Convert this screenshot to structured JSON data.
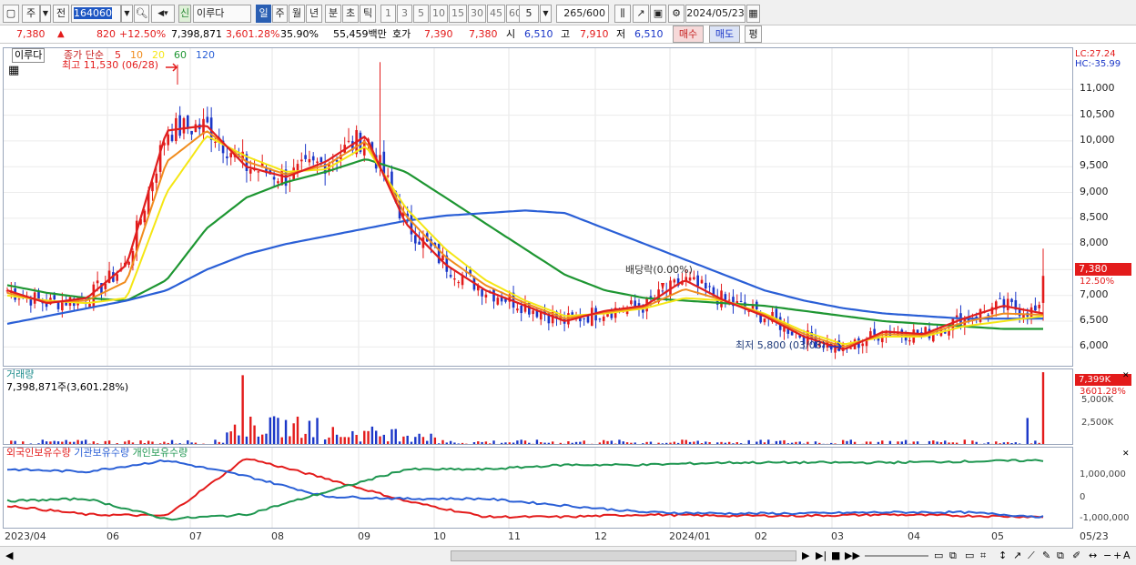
{
  "toolbar": {
    "market_label": "주",
    "period_label": "전",
    "code": "164060",
    "stock_name": "이루다",
    "badge_label": "신",
    "tf_daily": "일",
    "tf_week": "주",
    "tf_month": "월",
    "tf_year": "년",
    "tf_minute": "분",
    "tf_second": "초",
    "tf_tick": "틱",
    "intervals": [
      "1",
      "3",
      "5",
      "10",
      "15",
      "30",
      "45",
      "60"
    ],
    "interval_sel": "5",
    "count_value": "265",
    "count_total": "/600",
    "date_value": "2024/05/23"
  },
  "quote": {
    "price": "7,380",
    "change": "820",
    "change_pct": "+12.50%",
    "volume": "7,398,871",
    "volume_pct": "3,601.28%",
    "turnover": "35.90%",
    "amount": "55,459백만",
    "hoga_label": "호가",
    "hoga_ask": "7,390",
    "hoga_bid": "7,380",
    "open_label": "시",
    "open": "6,510",
    "high_label": "고",
    "high": "7,910",
    "low_label": "저",
    "low": "6,510",
    "buy_label": "매수",
    "sell_label": "매도",
    "eval_label": "평"
  },
  "main_panel": {
    "name_tag": "이루다",
    "ma_title": "종가 단순",
    "ma_periods": [
      "5",
      "10",
      "20",
      "60",
      "120"
    ],
    "max_label": "최고 11,530 (06/28)",
    "min_label": "최저 5,800 (03/08)",
    "dividend_label": "배당락(0.00%)",
    "lc_label": "LC:27.24",
    "hc_label": "HC:-35.99",
    "price_tag": "7,380",
    "price_tag_pct": "12.50%",
    "y_ticks": [
      "11,000",
      "10,500",
      "10,000",
      "9,500",
      "9,000",
      "8,500",
      "8,000",
      "7,500",
      "7,000",
      "6,500",
      "6,000"
    ]
  },
  "volume_panel": {
    "title": "거래량",
    "value_label": "7,398,871주(3,601.28%)",
    "tag": "7,399K",
    "tag_pct": "3601.28%",
    "y_ticks": [
      "5,000K",
      "2,500K"
    ]
  },
  "holding_panel": {
    "legend": [
      "외국인보유수량",
      "기관보유수량",
      "개인보유수량"
    ],
    "y_ticks": [
      "1,000,000",
      "0",
      "-1,000,000"
    ]
  },
  "x_axis": [
    "2023/04",
    "06",
    "07",
    "08",
    "09",
    "10",
    "11",
    "12",
    "2024/01",
    "02",
    "03",
    "04",
    "05",
    "05/23"
  ],
  "colors": {
    "ma5": "#e01e1e",
    "ma10": "#f08c1e",
    "ma20": "#f5e614",
    "ma60": "#1e9632",
    "ma120": "#2a5fd6",
    "up": "#e31b1b",
    "down": "#1b37c8"
  },
  "chart_data": [
    {
      "type": "candlestick",
      "title": "이루다",
      "ylim": [
        5600,
        11800
      ],
      "x": [
        "2023/04",
        "06",
        "07",
        "08",
        "09",
        "10",
        "11",
        "12",
        "2024/01",
        "02",
        "03",
        "04",
        "05"
      ],
      "series": [
        {
          "name": "5",
          "values": [
            7100,
            6850,
            6950,
            7600,
            10200,
            10300,
            9500,
            9300,
            9600,
            10100,
            8400,
            7600,
            7100,
            6800,
            6500,
            6700,
            6800,
            7300,
            6900,
            6600,
            6200,
            5950,
            6300,
            6250,
            6550,
            6800,
            6650
          ]
        },
        {
          "name": "20",
          "values": [
            7000,
            6900,
            6850,
            6950,
            9000,
            10100,
            9700,
            9400,
            9450,
            9900,
            8700,
            7900,
            7300,
            6900,
            6600,
            6650,
            6750,
            6950,
            6900,
            6650,
            6300,
            6050,
            6200,
            6200,
            6400,
            6500,
            6600
          ]
        },
        {
          "name": "60",
          "values": [
            7200,
            7050,
            6950,
            6900,
            7300,
            8300,
            8900,
            9200,
            9400,
            9650,
            9400,
            8900,
            8400,
            7900,
            7400,
            7100,
            6950,
            6900,
            6850,
            6800,
            6700,
            6600,
            6500,
            6450,
            6400,
            6350,
            6350
          ]
        },
        {
          "name": "120",
          "values": [
            6450,
            6600,
            6750,
            6900,
            7100,
            7500,
            7800,
            8000,
            8150,
            8300,
            8450,
            8550,
            8600,
            8650,
            8600,
            8300,
            8000,
            7700,
            7400,
            7100,
            6900,
            6750,
            6650,
            6600,
            6550,
            6550,
            6550
          ]
        }
      ],
      "max": 11530,
      "min": 5800,
      "last": 7380
    },
    {
      "type": "bar",
      "title": "거래량",
      "last": 7398871,
      "y_ticks": [
        2500000,
        5000000
      ]
    },
    {
      "type": "line",
      "title": "보유수량",
      "series": [
        {
          "name": "외국인보유수량",
          "values": [
            -600000,
            -1000000,
            -1050000,
            1500000,
            600000,
            -400000,
            -1100000,
            -1100000,
            -1000000,
            -1050000,
            -1050000,
            -1000000,
            -1050000,
            -1100000
          ]
        },
        {
          "name": "기관보유수량",
          "values": [
            1000000,
            900000,
            1400000,
            700000,
            -200000,
            -300000,
            -300000,
            -600000,
            -900000,
            -950000,
            -950000,
            -900000,
            -900000,
            -1100000
          ]
        },
        {
          "name": "개인보유수량",
          "values": [
            -400000,
            -300000,
            -1200000,
            -1000000,
            0,
            1000000,
            1000000,
            1200000,
            1200000,
            1300000,
            1300000,
            1300000,
            1350000,
            1400000
          ]
        }
      ]
    }
  ]
}
